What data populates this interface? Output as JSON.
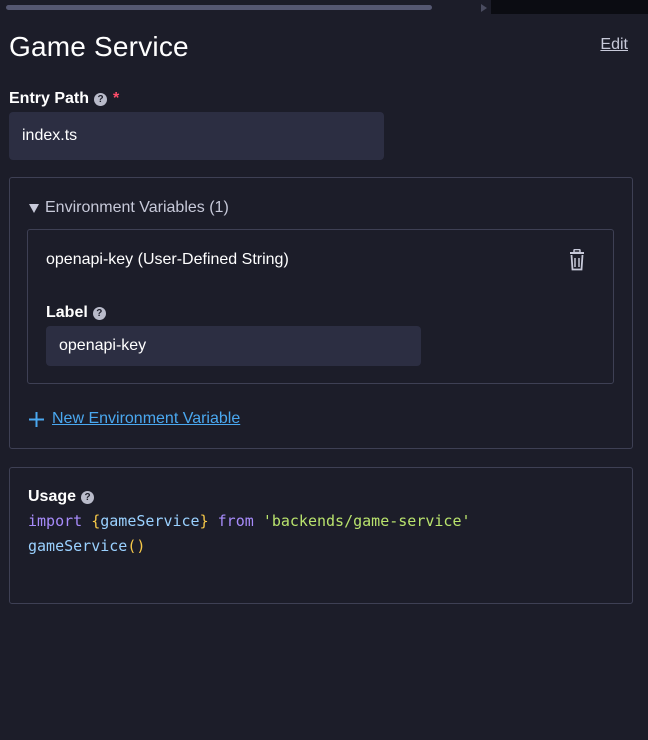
{
  "window": {
    "title": "Game Service",
    "edit_label": "Edit"
  },
  "entry_path": {
    "label": "Entry Path",
    "required_mark": "*",
    "value": "index.ts"
  },
  "environment": {
    "header": "Environment Variables (1)",
    "variables": [
      {
        "title": "openapi-key (User-Defined String)",
        "label_field_label": "Label",
        "label_value": "openapi-key"
      }
    ],
    "new_button_label": "New Environment Variable"
  },
  "usage": {
    "label": "Usage",
    "line1": {
      "kw_import": "import",
      "brace_open": "{",
      "name": "gameService",
      "brace_close": "}",
      "kw_from": "from",
      "module": "'backends/game-service'"
    },
    "line2": {
      "fn": "gameService",
      "parens": "()"
    }
  },
  "icons": {
    "help": "question-circle-icon",
    "trash": "trash-icon",
    "plus": "plus-icon",
    "caret": "caret-down-icon"
  },
  "colors": {
    "background": "#1c1d29",
    "input_bg": "#2c2e42",
    "link": "#4aa8f0",
    "required": "#ff4d6a"
  }
}
